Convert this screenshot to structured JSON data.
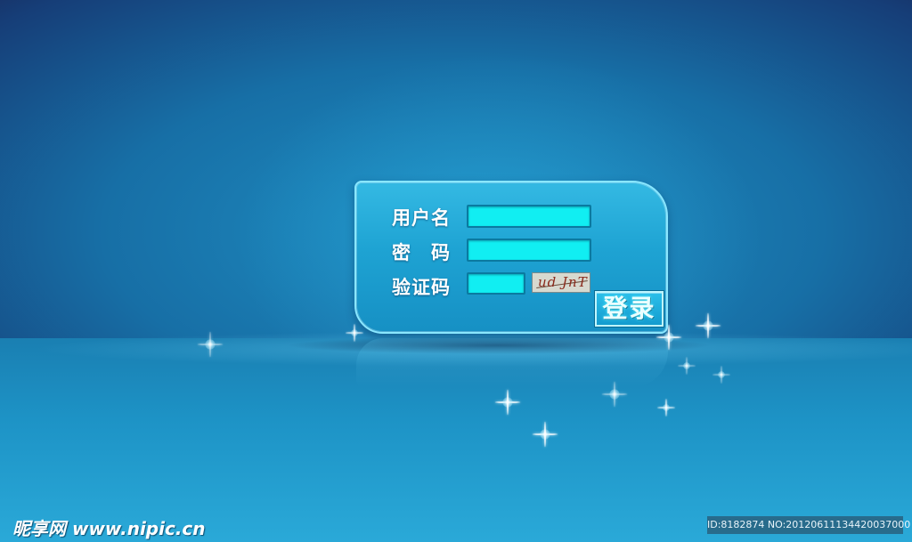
{
  "login_form": {
    "username_label": "用户名",
    "password_label": "密　码",
    "captcha_label": "验证码",
    "username_value": "",
    "password_value": "",
    "captcha_value": "",
    "captcha_image_text": "ud JnT",
    "login_button_label": "登录"
  },
  "watermark": {
    "site_text": "昵享网 www.nipic.cn",
    "id_text": "ID:8182874 NO:20120611134420037000"
  },
  "colors": {
    "background_center": "#1f8fc3",
    "background_edge": "#1a1c48",
    "panel_fill": "#1ea3d3",
    "panel_border": "#8ae7ff",
    "input_fill": "#11eef2",
    "button_text": "#eaffff"
  },
  "icons": {
    "sparkle": "sparkle-icon"
  }
}
